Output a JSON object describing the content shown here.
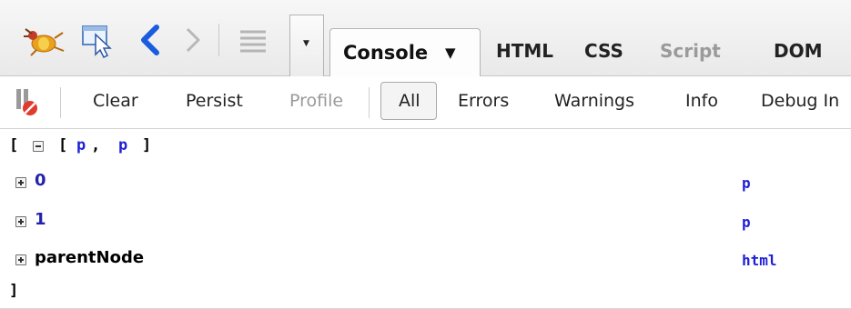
{
  "tabbar": {
    "tabs": [
      {
        "label": "Console",
        "active": true
      },
      {
        "label": "HTML"
      },
      {
        "label": "CSS"
      },
      {
        "label": "Script",
        "disabled": true
      },
      {
        "label": "DOM"
      }
    ],
    "console_caret": "▼",
    "dropdown_arrow": "▼"
  },
  "toolbar": {
    "clear": "Clear",
    "persist": "Persist",
    "profile": "Profile",
    "all": "All",
    "errors": "Errors",
    "warnings": "Warnings",
    "info": "Info",
    "debug": "Debug In"
  },
  "console": {
    "open_bracket": "[",
    "array_label": "[",
    "array_items": [
      "p",
      ", ",
      "p"
    ],
    "array_close": "]",
    "rows": [
      {
        "key": "0",
        "value": "p"
      },
      {
        "key": "1",
        "value": "p"
      },
      {
        "key": "parentNode",
        "value": "html"
      }
    ],
    "close_bracket": "]"
  },
  "colors": {
    "value_blue": "#1f1fd6",
    "key_blue": "#2222aa"
  }
}
